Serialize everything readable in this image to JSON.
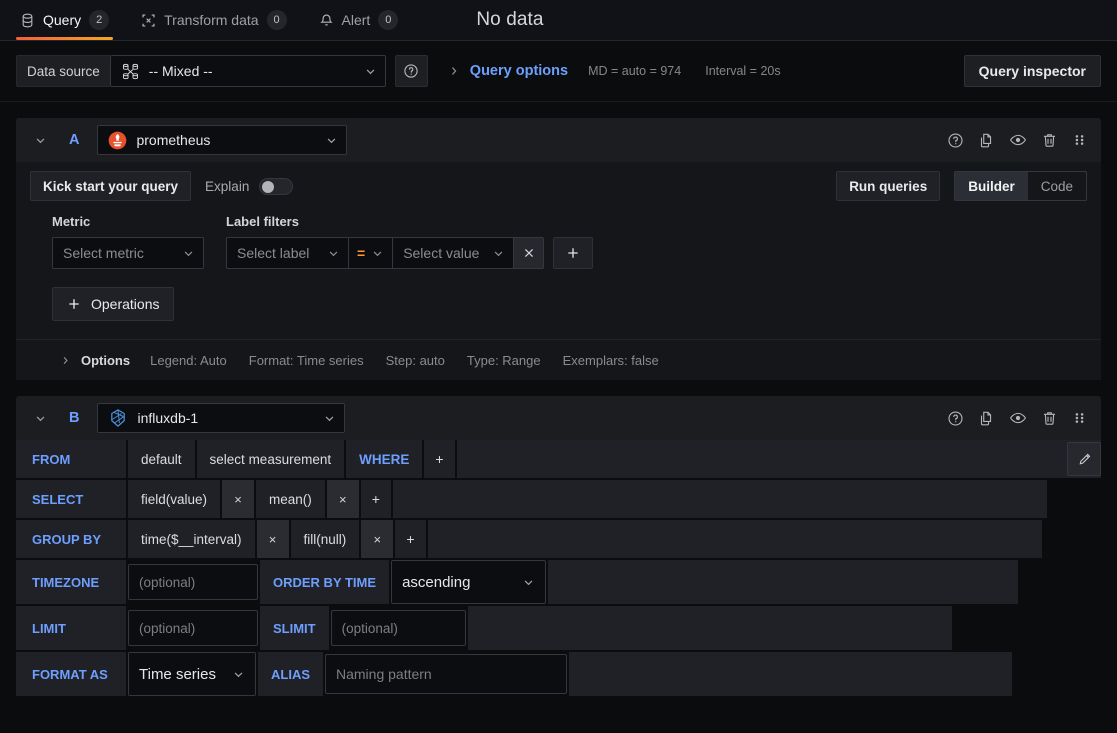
{
  "tabs": [
    {
      "label": "Query",
      "count": "2",
      "icon": "database-icon",
      "active": true
    },
    {
      "label": "Transform data",
      "count": "0",
      "icon": "process-icon",
      "active": false
    },
    {
      "label": "Alert",
      "count": "0",
      "icon": "bell-icon",
      "active": false
    }
  ],
  "panel_status": "No data",
  "datasource_row": {
    "label": "Data source",
    "selected": "-- Mixed --",
    "icon": "mixed-datasource-icon",
    "help_icon": "help-circle-icon",
    "query_options": {
      "title": "Query options",
      "expand_icon": "chevron-right-icon",
      "max_data_points": "MD = auto = 974",
      "interval": "Interval = 20s"
    },
    "query_inspector": "Query inspector"
  },
  "queries": [
    {
      "ref_id": "A",
      "datasource": "prometheus",
      "datasource_icon": "prometheus-icon",
      "actions": [
        "help-circle-icon",
        "copy-icon",
        "eye-icon",
        "trash-icon",
        "drag-handle-icon"
      ],
      "toolbar": {
        "kickstart": "Kick start your query",
        "explain_label": "Explain",
        "explain_on": false,
        "run_queries": "Run queries",
        "modes": [
          "Builder",
          "Code"
        ],
        "mode_selected": "Builder"
      },
      "metric": {
        "label": "Metric",
        "placeholder": "Select metric"
      },
      "label_filters": {
        "label": "Label filters",
        "label_placeholder": "Select label",
        "operator": "=",
        "value_placeholder": "Select value",
        "remove_icon": "close-icon",
        "add_icon": "plus-icon"
      },
      "operations_button": "Operations",
      "options": {
        "title": "Options",
        "expand_icon": "chevron-right-icon",
        "items": [
          "Legend: Auto",
          "Format: Time series",
          "Step: auto",
          "Type: Range",
          "Exemplars: false"
        ]
      }
    },
    {
      "ref_id": "B",
      "datasource": "influxdb-1",
      "datasource_icon": "influxdb-icon",
      "actions": [
        "help-circle-icon",
        "copy-icon",
        "eye-icon",
        "trash-icon",
        "drag-handle-icon"
      ],
      "editor": {
        "from": {
          "label": "FROM",
          "policy": "default",
          "measurement": "select measurement",
          "where": "WHERE",
          "add": "+",
          "edit_icon": "pencil-icon"
        },
        "select": {
          "label": "SELECT",
          "parts": [
            "field(value)",
            "mean()"
          ],
          "remove": "×",
          "add": "+"
        },
        "group_by": {
          "label": "GROUP BY",
          "parts": [
            "time($__interval)",
            "fill(null)"
          ],
          "remove": "×",
          "add": "+"
        },
        "timezone": {
          "label": "TIMEZONE",
          "placeholder": "(optional)",
          "value": ""
        },
        "order_by_time": {
          "label": "ORDER BY TIME",
          "value": "ascending"
        },
        "limit": {
          "label": "LIMIT",
          "placeholder": "(optional)",
          "value": ""
        },
        "slimit": {
          "label": "SLIMIT",
          "placeholder": "(optional)",
          "value": ""
        },
        "format_as": {
          "label": "FORMAT AS",
          "value": "Time series"
        },
        "alias": {
          "label": "ALIAS",
          "placeholder": "Naming pattern",
          "value": ""
        }
      }
    }
  ],
  "colors": {
    "accent_blue": "#6e9fff",
    "accent_orange": "#ff9830",
    "tab_underline": "#f55f3e",
    "panel_bg": "#141619",
    "page_bg": "#0b0c0e"
  }
}
